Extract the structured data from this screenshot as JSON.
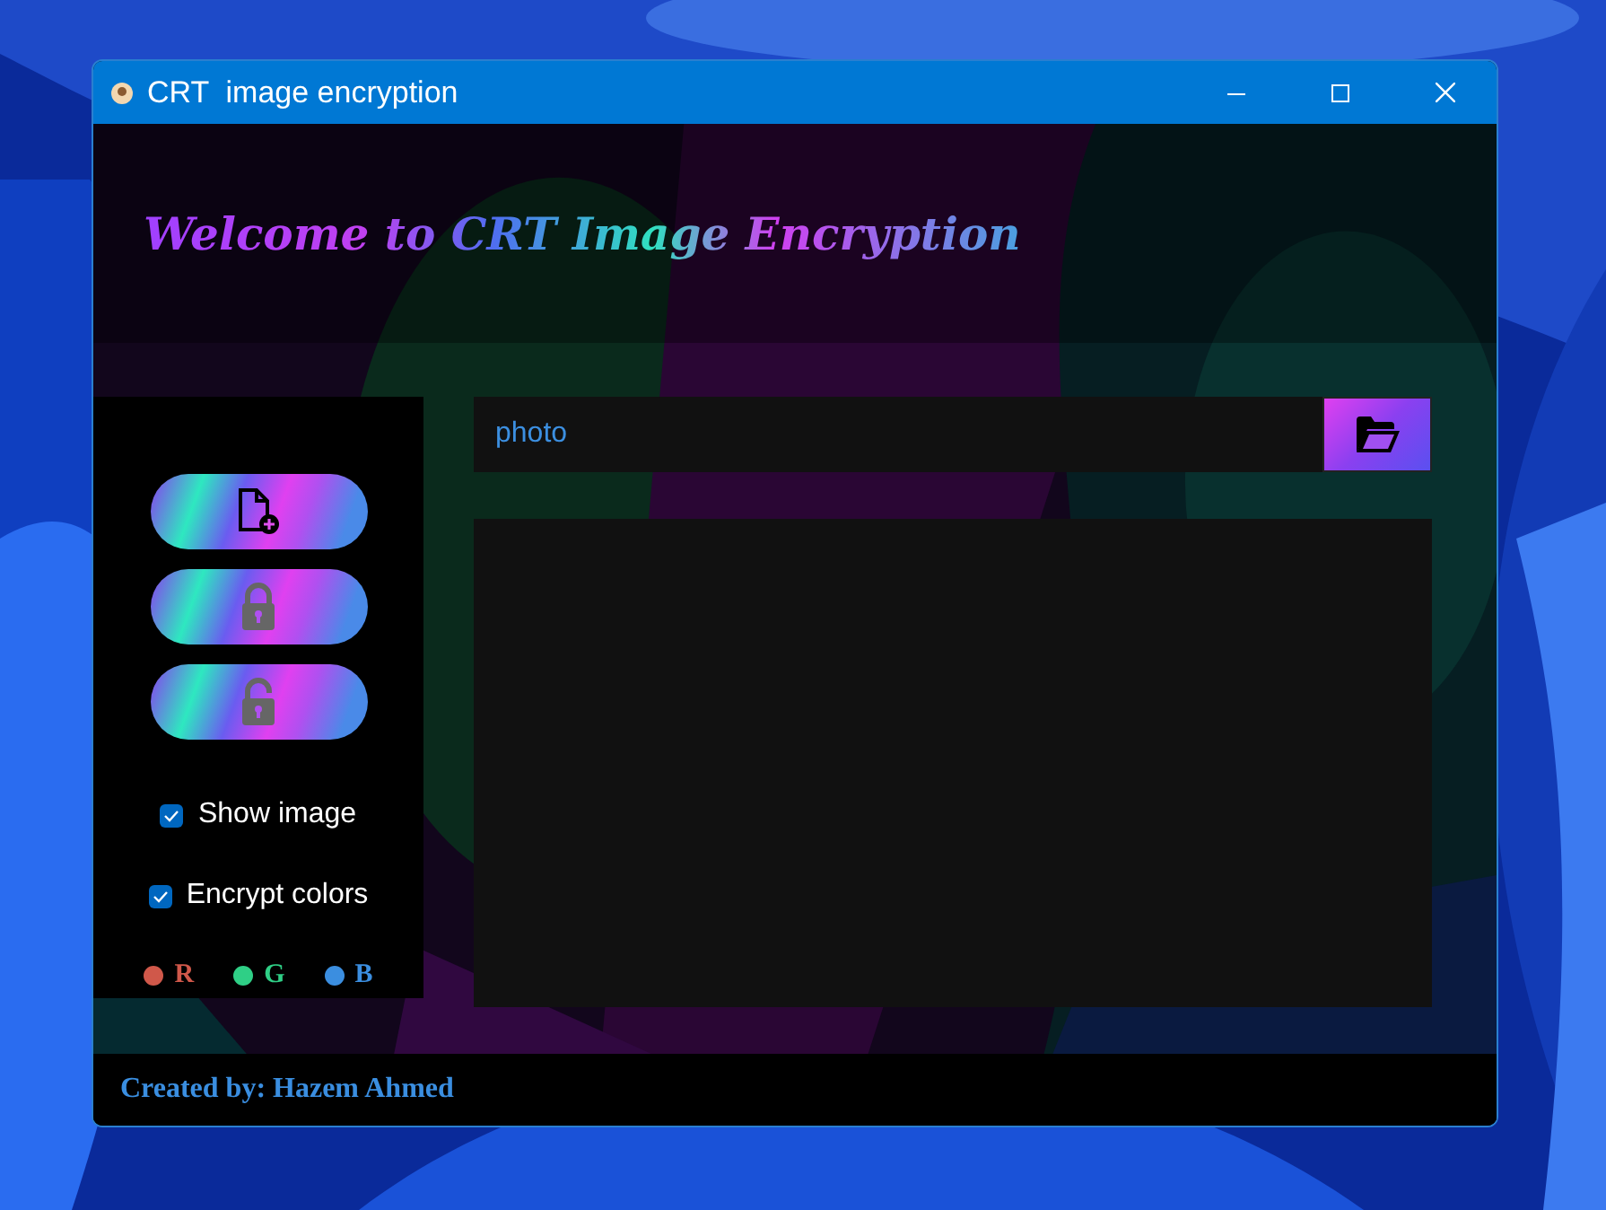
{
  "window": {
    "title": "CRT  image encryption"
  },
  "header": {
    "title": "Welcome to CRT Image Encryption"
  },
  "sidebar": {
    "checkboxes": [
      {
        "label": "Show image",
        "checked": true
      },
      {
        "label": "Encrypt colors",
        "checked": true
      }
    ],
    "channels": [
      {
        "label": "R",
        "color": "#d0584a"
      },
      {
        "label": "G",
        "color": "#2fcf86"
      },
      {
        "label": "B",
        "color": "#3b8ee0"
      }
    ]
  },
  "file_field": {
    "value": "photo"
  },
  "footer": {
    "credit": "Created by: Hazem Ahmed"
  }
}
